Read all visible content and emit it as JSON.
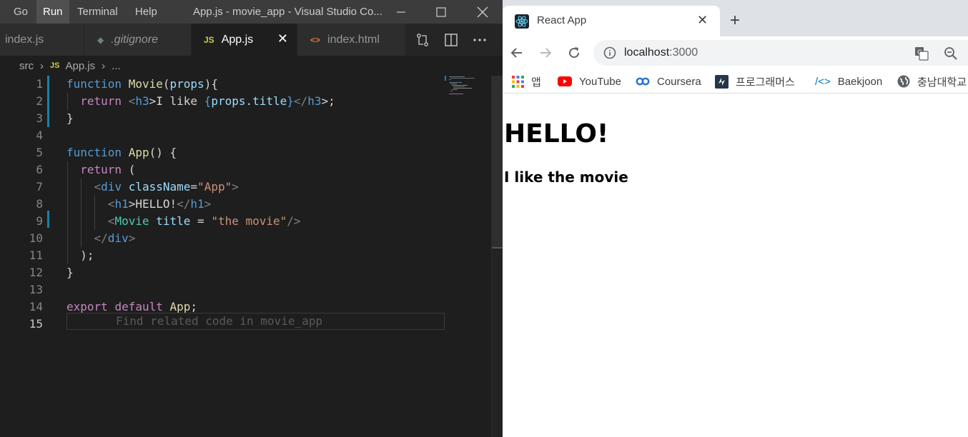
{
  "vscode": {
    "menu": [
      "Go",
      "Run",
      "Terminal",
      "Help"
    ],
    "active_menu": "Run",
    "window_title": "App.js - movie_app - Visual Studio Co...",
    "tabs": [
      {
        "label": "index.js",
        "icon": "",
        "active": false
      },
      {
        "label": ".gitignore",
        "icon": "◆",
        "active": false
      },
      {
        "label": "App.js",
        "icon": "JS",
        "active": true
      },
      {
        "label": "index.html",
        "icon": "<>",
        "active": false
      }
    ],
    "breadcrumb": {
      "folder": "src",
      "file_icon": "JS",
      "file": "App.js",
      "more": "..."
    },
    "line_numbers": [
      "1",
      "2",
      "3",
      "4",
      "5",
      "6",
      "7",
      "8",
      "9",
      "10",
      "11",
      "12",
      "13",
      "14",
      "15"
    ],
    "current_line": "15",
    "code_tokens": {
      "l1": [
        "function",
        "Movie",
        "(",
        "props",
        "){"
      ],
      "l2": [
        "return",
        "<",
        "h3",
        ">I like ",
        "{",
        "props.title",
        "}",
        "</",
        "h3",
        ">;"
      ],
      "l3": [
        "}"
      ],
      "l5": [
        "function",
        "App",
        "() {"
      ],
      "l6": [
        "return",
        " ("
      ],
      "l7": [
        "<",
        "div",
        "className",
        "=",
        "\"App\"",
        ">"
      ],
      "l8": [
        "<",
        "h1",
        ">HELLO!",
        "</",
        "h1",
        ">"
      ],
      "l9": [
        "<",
        "Movie",
        "title",
        " = ",
        "\"the movie\"",
        "/>"
      ],
      "l10": [
        "</",
        "div",
        ">"
      ],
      "l11": [
        ");"
      ],
      "l12": [
        "}"
      ],
      "l14": [
        "export",
        "default",
        "App",
        ";"
      ]
    },
    "code_hint": "Find related code in movie_app"
  },
  "chrome": {
    "tab_title": "React App",
    "url_host": "localhost",
    "url_port": ":3000",
    "bookmarks": [
      {
        "label": "앱",
        "icon": "apps-grid-icon"
      },
      {
        "label": "YouTube",
        "icon": "youtube-icon"
      },
      {
        "label": "Coursera",
        "icon": "coursera-icon"
      },
      {
        "label": "프로그래머스",
        "icon": "programmers-icon"
      },
      {
        "label": "Baekjoon",
        "icon": "code-brackets-icon"
      },
      {
        "label": "충남대학교",
        "icon": "globe-icon"
      }
    ],
    "page": {
      "heading": "HELLO!",
      "subheading": "I like the movie"
    }
  },
  "colors": {
    "keyword": "#569cd6",
    "control": "#c586c0",
    "function": "#dcdcaa",
    "variable": "#9cdcfe",
    "component": "#4ec9b0",
    "string": "#ce9178",
    "editor_bg": "#1e1e1e",
    "titlebar": "#3c3c3c"
  }
}
